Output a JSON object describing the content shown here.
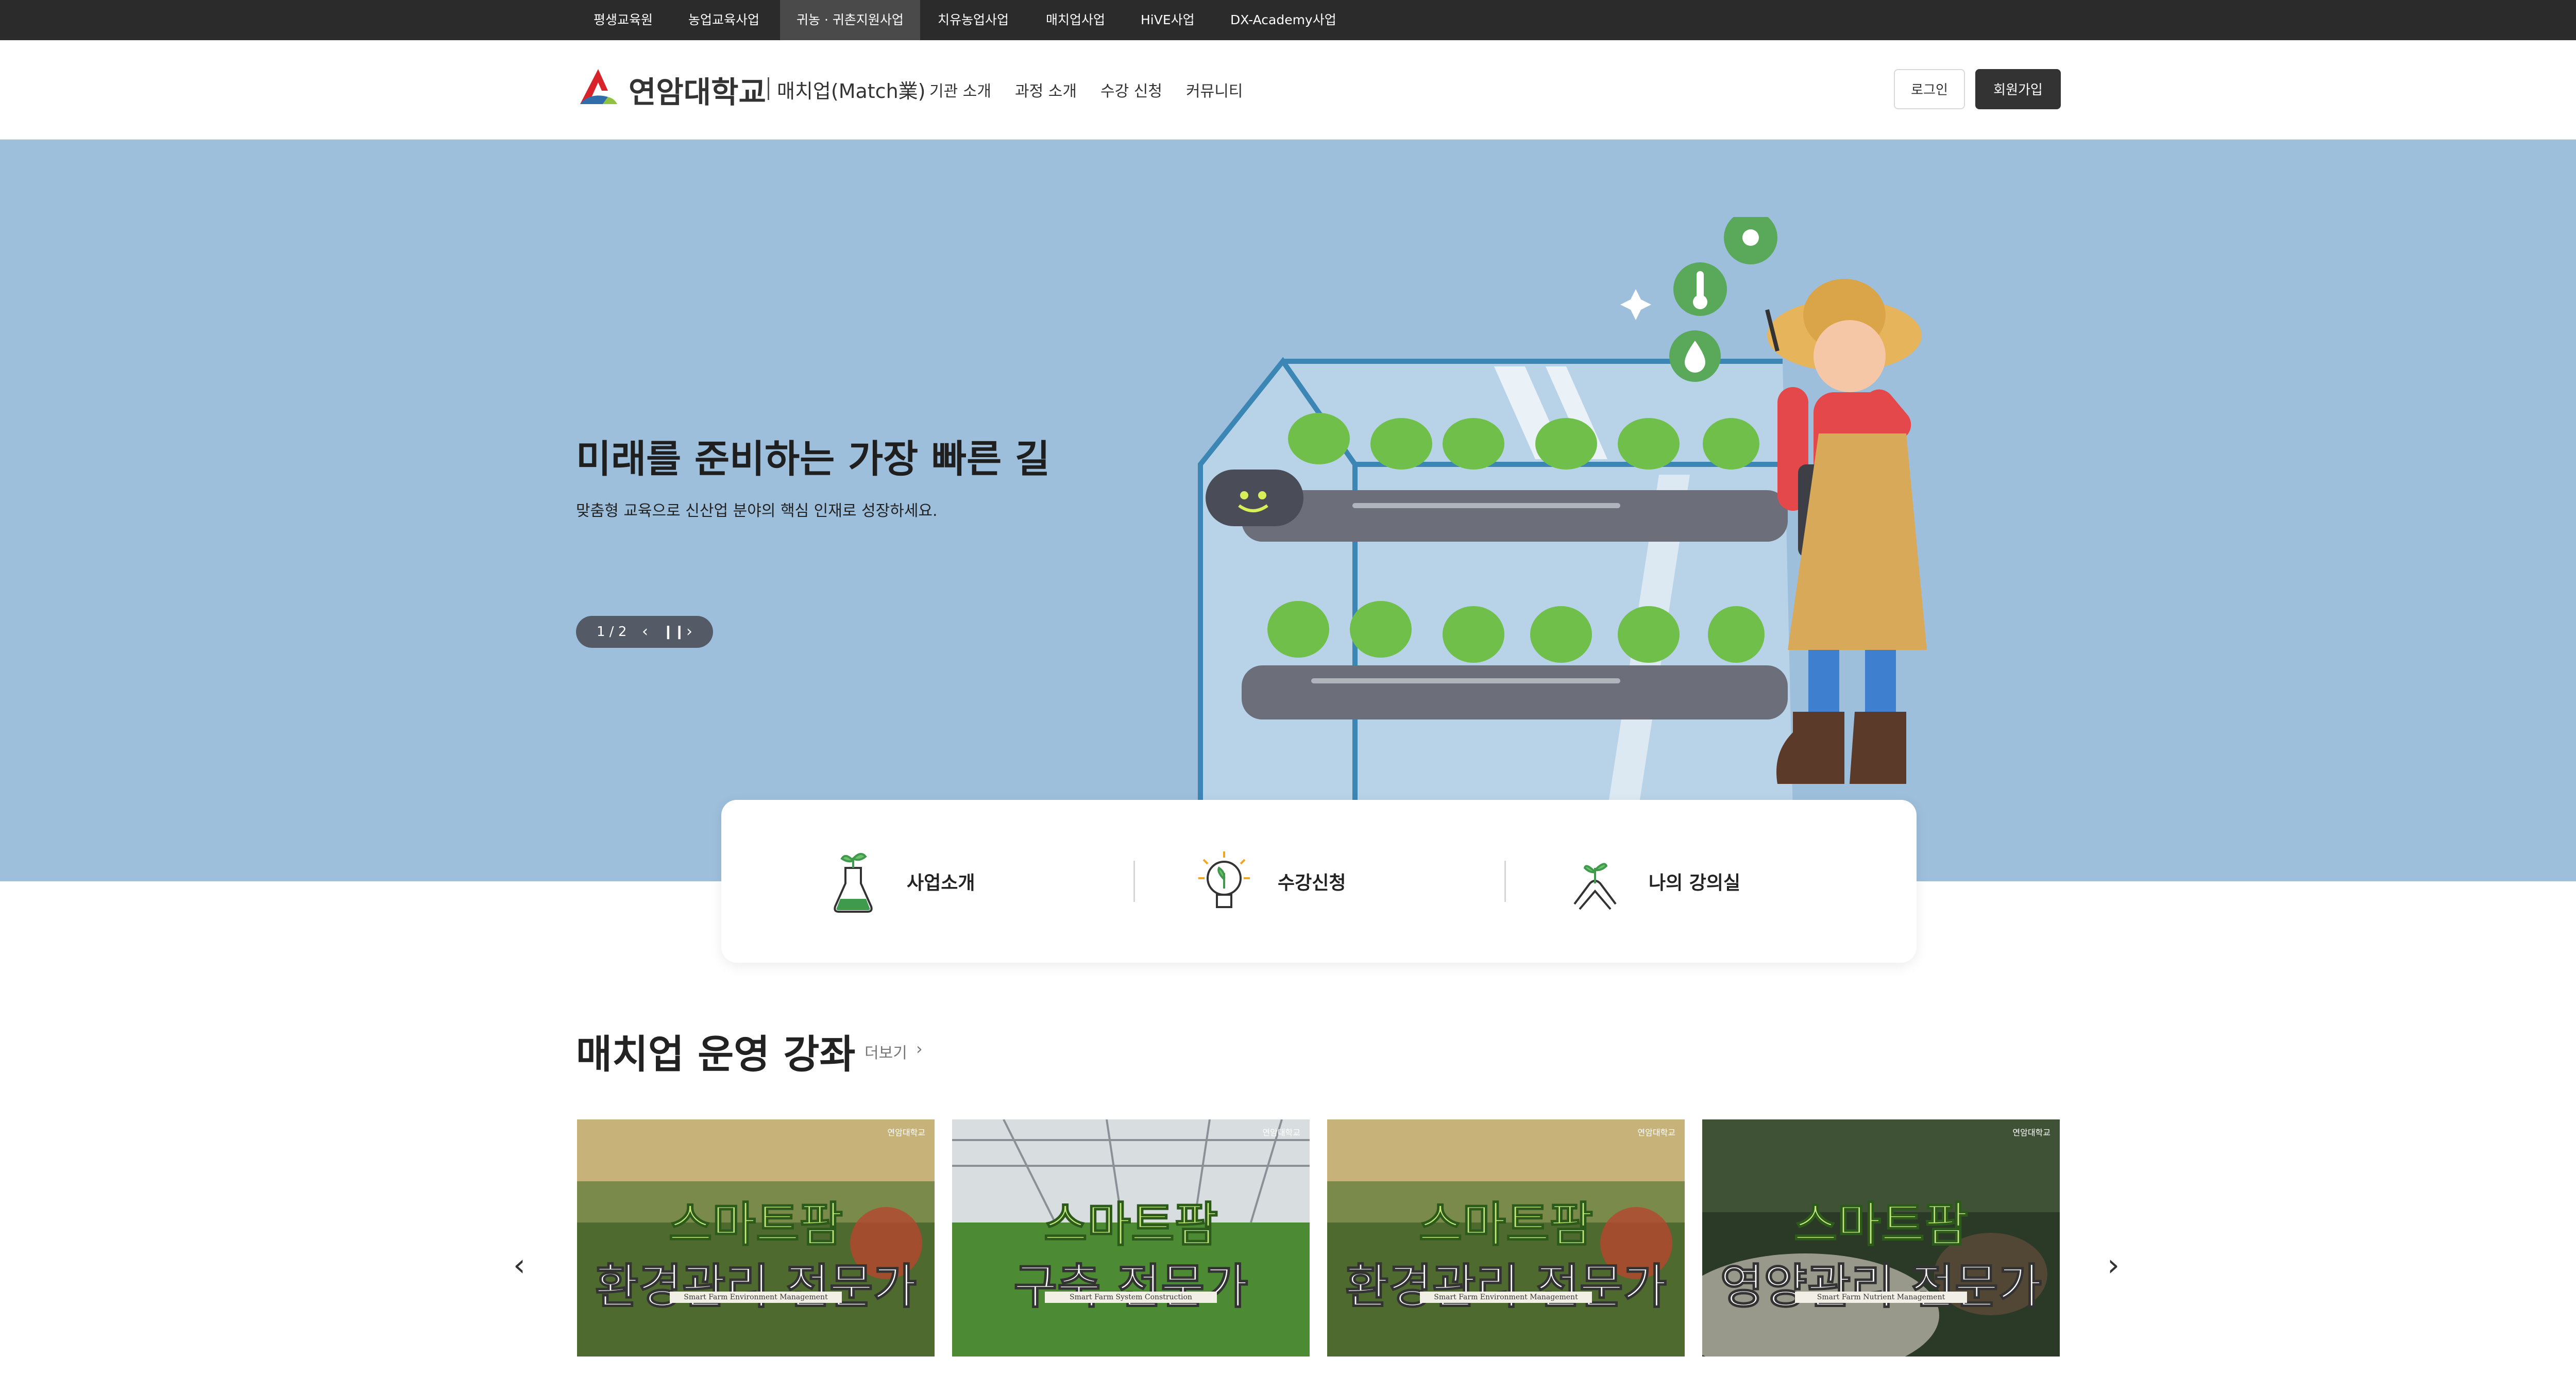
{
  "topbar": {
    "items": [
      {
        "label": "평생교육원",
        "active": false
      },
      {
        "label": "농업교육사업",
        "active": false
      },
      {
        "label": "귀농 · 귀촌지원사업",
        "active": true
      },
      {
        "label": "치유농업사업",
        "active": false
      },
      {
        "label": "매치업사업",
        "active": false
      },
      {
        "label": "HiVE사업",
        "active": false
      },
      {
        "label": "DX-Academy사업",
        "active": false
      }
    ]
  },
  "header": {
    "logo_text": "연암대학교",
    "logo_sub": "매치업(Match業)",
    "nav": [
      "기관 소개",
      "과정 소개",
      "수강 신청",
      "커뮤니티"
    ],
    "login_label": "로그인",
    "signup_label": "회원가입"
  },
  "hero": {
    "title": "미래를 준비하는 가장 빠른 길",
    "subtitle": "맞춤형 교육으로 신산업 분야의 핵심 인재로 성장하세요.",
    "pager": {
      "current": 1,
      "total": 2,
      "label": "1 / 2"
    },
    "background_color": "#9dbfdc"
  },
  "quick_links": [
    {
      "label": "사업소개",
      "icon": "flask-sprout-icon"
    },
    {
      "label": "수강신청",
      "icon": "lightbulb-leaf-icon"
    },
    {
      "label": "나의 강의실",
      "icon": "hands-sprout-icon"
    }
  ],
  "courses_section": {
    "title": "매치업 운영 강좌",
    "more_label": "더보기",
    "cards": [
      {
        "line1": "스마트팜",
        "line2": "환경관리 전문가",
        "line3": "Smart Farm Environment Management",
        "brand": "연암대학교"
      },
      {
        "line1": "스마트팜",
        "line2": "구축 전문가",
        "line3": "Smart Farm System Construction",
        "brand": "연암대학교"
      },
      {
        "line1": "스마트팜",
        "line2": "환경관리 전문가",
        "line3": "Smart Farm Environment Management",
        "brand": "연암대학교"
      },
      {
        "line1": "스마트팜",
        "line2": "영양관리 전문가",
        "line3": "Smart Farm Nutrient Management",
        "brand": "연암대학교"
      }
    ]
  }
}
